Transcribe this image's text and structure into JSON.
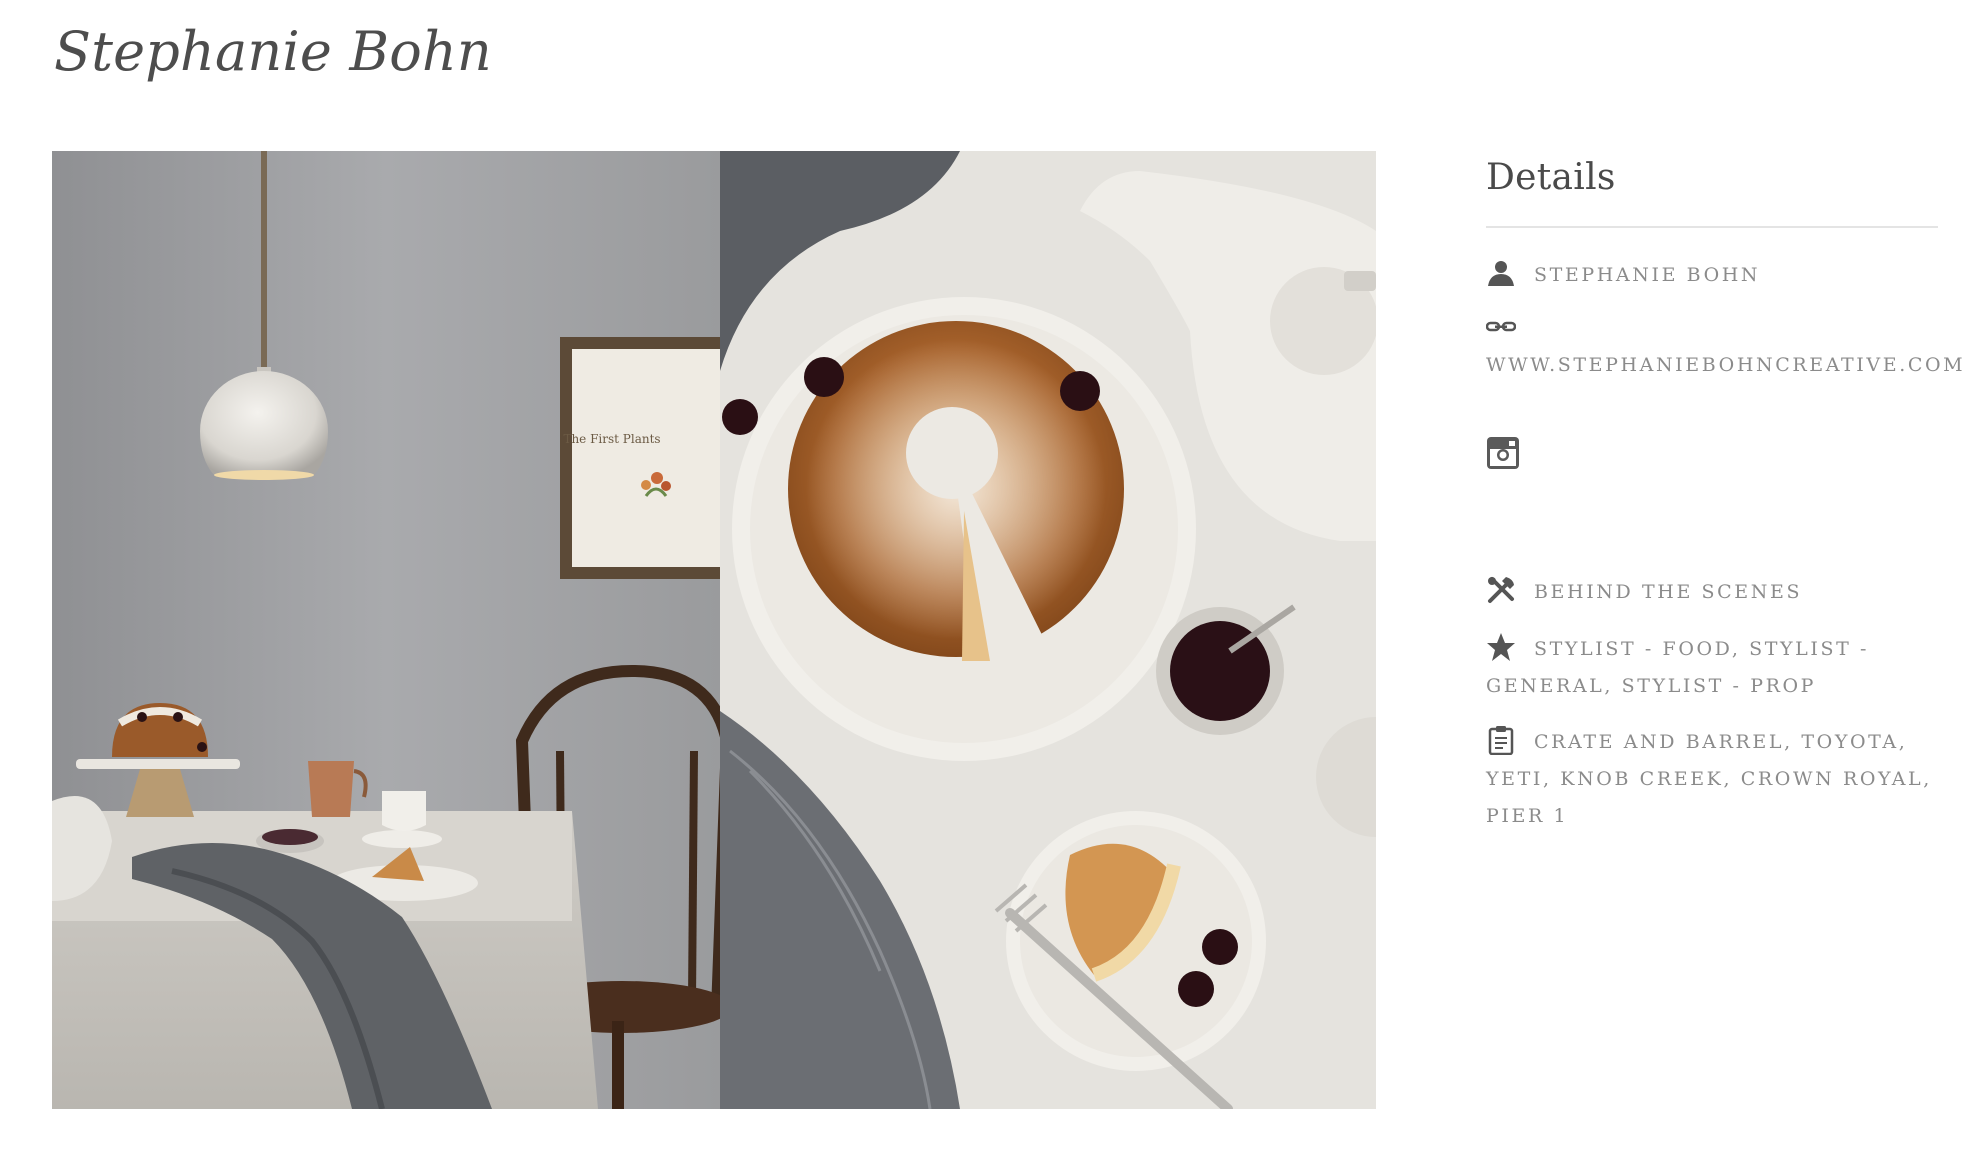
{
  "page": {
    "title": "Stephanie Bohn"
  },
  "gallery": {
    "left_photo": {
      "content": "dining-room-scene",
      "framed_print_text": "The First Plants"
    },
    "right_photo": {
      "content": "overhead-bundt-cake"
    }
  },
  "details": {
    "heading": "Details",
    "artist": {
      "icon": "person-icon",
      "label": "STEPHANIE BOHN"
    },
    "website": {
      "icon": "link-icon",
      "label": "WWW.STEPHANIEBOHNCREATIVE.COM"
    },
    "social": {
      "icon": "instagram-icon"
    },
    "category": {
      "icon": "tools-icon",
      "label": "BEHIND THE SCENES"
    },
    "roles": {
      "icon": "star-icon",
      "items": [
        "STYLIST - FOOD",
        "STYLIST - GENERAL",
        "STYLIST - PROP"
      ],
      "separator": ", "
    },
    "clients": {
      "icon": "clipboard-icon",
      "items": [
        "CRATE AND BARREL",
        "TOYOTA",
        "YETI",
        "KNOB CREEK",
        "CROWN ROYAL",
        "PIER 1"
      ],
      "separator": ", "
    }
  }
}
